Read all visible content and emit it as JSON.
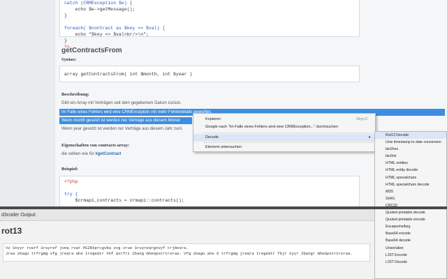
{
  "code_top": {
    "lines": [
      "catch (CRMException $e) {",
      "    echo $e->getMessage();",
      "}",
      "",
      "foreach( $contract as $key => $val) {",
      "    echo \"$key => $val<br/>\\n\";",
      "}",
      "?>"
    ]
  },
  "section": {
    "title": "getContractsFrom",
    "syntax_label": "Syntax:",
    "syntax_code": "array getContractsFrom( int $month, int $year )",
    "desc_label": "Beschreibung:",
    "desc_line": "Gibt ein Array mit Verträgen seit dem gegebenem Datum zurück.",
    "sel_line1": "Im Falle eines Fehlers wird eine CRMException mit mehr Fehlerdetails geworfen.",
    "sel_line2": "Wenn month gesetzt ist werden nur Verträge aus diesem Monat",
    "plain_line": "Wenn year gesetzt ist werden nur Verträge aus diesem Jahr zurü",
    "props_label": "Eigenschaften von contracts array:",
    "props_text": "die selben wie für",
    "props_link": "#getContract",
    "example_label": "Beispiel:"
  },
  "code_bottom": {
    "lines": [
      "<?php",
      "",
      "try {",
      "    $crmapi_contracts = crmapi::contracts();"
    ]
  },
  "context_menu": {
    "items": [
      {
        "label": "Kopieren",
        "shortcut": "Strg+C"
      },
      {
        "label": "Google nach \"Im Falle eines Fehlers wird eine CRMException...\" durchsuchen",
        "shortcut": ""
      },
      {
        "label": "Decode",
        "shortcut": ""
      },
      {
        "label": "Element untersuchen",
        "shortcut": ""
      }
    ]
  },
  "submenu": {
    "items": [
      "Rot13 Decode",
      "Unix timestamp to date conversion",
      "bin2hex",
      "bin2txt",
      "HTML entities",
      "HTML entity decode",
      "HTML specialchars",
      "HTML specialchars decode",
      "MD5",
      "SHA1",
      "CRC32",
      "Quoted printable decode",
      "Quoted printable encode",
      "Escapeshellarg",
      "Base64 encode",
      "Base64 decode",
      "Unserialize",
      "L33T Encode",
      "L33T Decode"
    ]
  },
  "output": {
    "header": "d3coder Output:",
    "title": "rot13",
    "line1": "Vz Snyyr rvarf Sruyref jveq rvar PEZRkprcgvba zvg zrue Sruyreqrgnvyf trjbesra.",
    "line2": "Jraa zbagu trfrgmg vfg jreqra ahe Iregeätr nhf qvrfrz Zbang mheüpxtrtroraa. Vfg zbagu ahe 0 trfrgmg jreqra Iregeätr fbjr nyyr Zbangr mheüpxtrtroraa."
  }
}
